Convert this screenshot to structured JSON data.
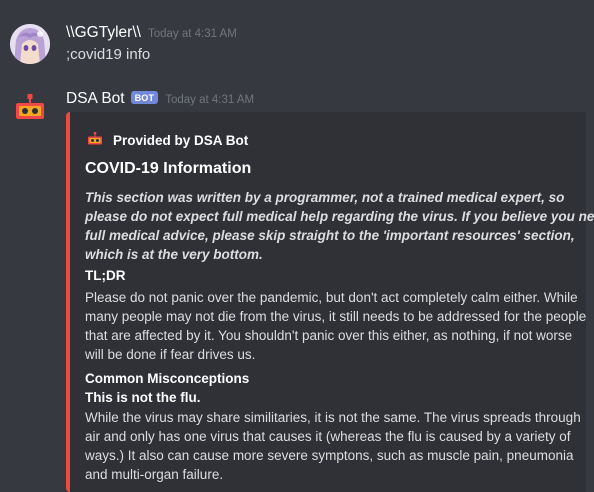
{
  "messages": [
    {
      "author": "\\\\GGTyler\\\\",
      "timestamp": "Today at 4:31 AM",
      "content": ";covid19 info"
    },
    {
      "author": "DSA Bot",
      "bot_tag": "BOT",
      "timestamp": "Today at 4:31 AM",
      "embed": {
        "accent_color": "#e74c3c",
        "author_name": "Provided by DSA Bot",
        "title": "COVID-19 Information",
        "description_lines": [
          "This section was written by a programmer, not a trained medical expert, so",
          "please do not expect full medical help regarding the virus. If you believe you need",
          "full medical advice, please skip straight to the 'important resources' section,",
          "which is at the very bottom."
        ],
        "fields": [
          {
            "name": "TL;DR",
            "value_lines": [
              "Please do not panic over the pandemic, but don't act completely calm either. While",
              "many people may not die from the virus, it still needs to be addressed for the people",
              "that are affected by it. You shouldn't panic over this either, as nothing, if not worse",
              "will be done if fear drives us."
            ]
          },
          {
            "name": "Common Misconceptions",
            "subheading": "This is not the flu.",
            "value_lines": [
              "While the virus may share similitaries, it is not the same. The virus spreads through",
              "air and only has one virus that causes it (whereas the flu is caused by a variety of",
              "ways.) It also can cause more severe symptons, such as muscle pain, pneumonia",
              "and multi-organ failure."
            ]
          }
        ]
      }
    }
  ],
  "colors": {
    "background": "#36393f",
    "embed_background": "#2f3136",
    "bot_tag": "#7289da",
    "bot_avatar_bg": "#36393f",
    "bot_icon": "#f04747"
  },
  "icons": {
    "user_avatar": "anime-character-avatar",
    "bot_avatar": "robot-icon",
    "embed_author_icon": "robot-icon"
  }
}
